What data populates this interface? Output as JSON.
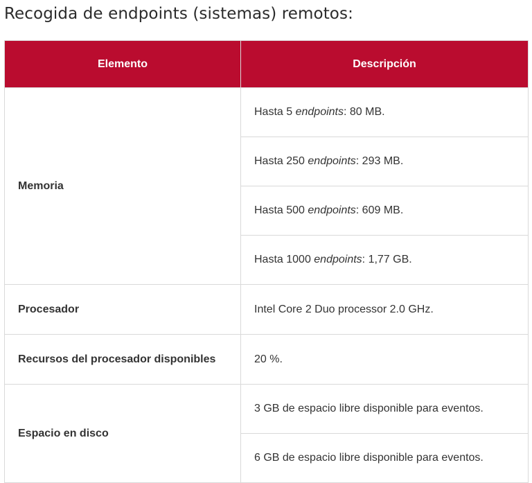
{
  "page": {
    "title": "Recogida de endpoints (sistemas) remotos:"
  },
  "table": {
    "headers": [
      "Elemento",
      "Descripción"
    ],
    "memoria": {
      "label": "Memoria",
      "values": [
        {
          "prefix": "Hasta 5 ",
          "em": "endpoints",
          "suffix": ": 80 MB."
        },
        {
          "prefix": "Hasta 250 ",
          "em": "endpoints",
          "suffix": ": 293 MB."
        },
        {
          "prefix": "Hasta 500 ",
          "em": "endpoints",
          "suffix": ": 609 MB."
        },
        {
          "prefix": "Hasta 1000 ",
          "em": "endpoints",
          "suffix": ": 1,77 GB."
        }
      ]
    },
    "procesador": {
      "label": "Procesador",
      "value": "Intel Core 2 Duo processor 2.0 GHz."
    },
    "recursos": {
      "label": "Recursos del procesador disponibles",
      "value": "20 %."
    },
    "disco": {
      "label": "Espacio en disco",
      "values": [
        "3 GB de espacio libre disponible para eventos.",
        "6 GB de espacio libre disponible para eventos."
      ]
    }
  }
}
